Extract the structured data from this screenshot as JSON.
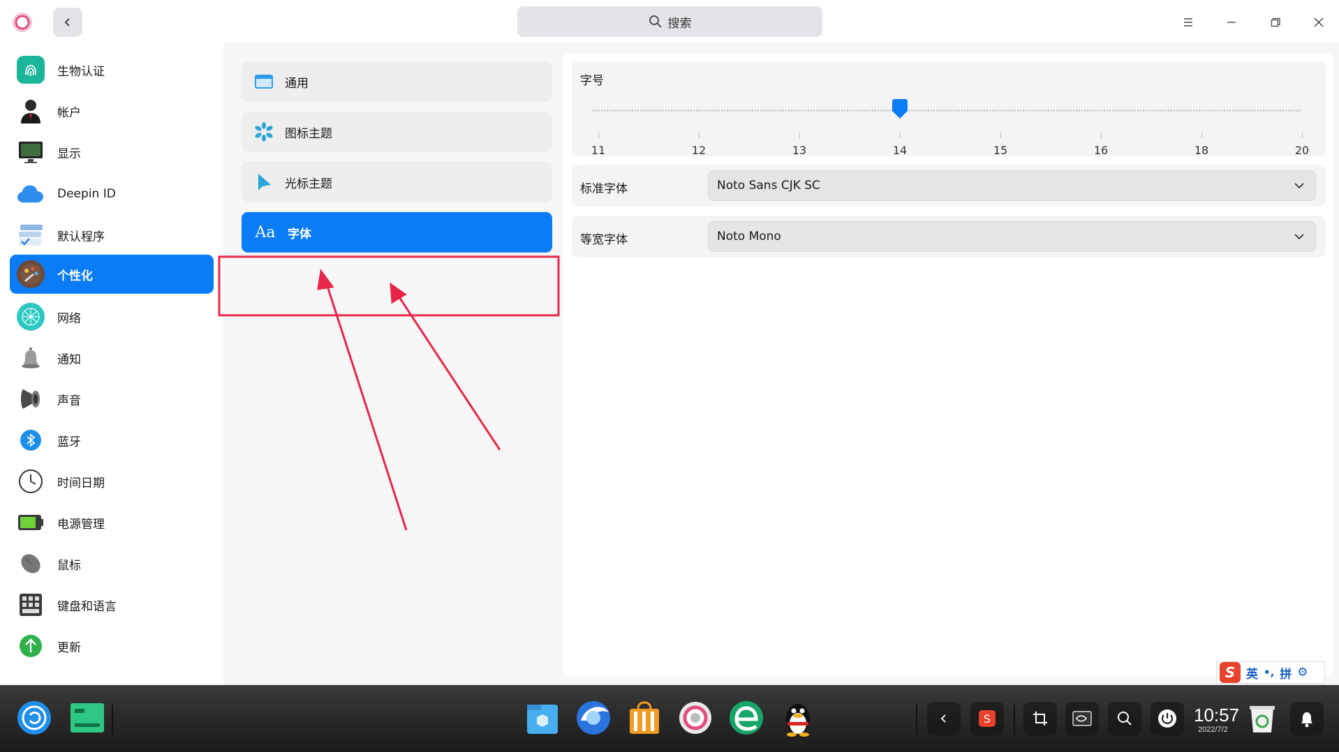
{
  "search": {
    "placeholder": "搜索"
  },
  "sidebar": {
    "items": [
      {
        "label": "生物认证",
        "icon": "fingerprint-icon"
      },
      {
        "label": "帐户",
        "icon": "account-icon"
      },
      {
        "label": "显示",
        "icon": "display-icon"
      },
      {
        "label": "Deepin ID",
        "icon": "cloud-icon"
      },
      {
        "label": "默认程序",
        "icon": "default-apps-icon"
      },
      {
        "label": "个性化",
        "icon": "personalization-icon",
        "active": true
      },
      {
        "label": "网络",
        "icon": "network-icon"
      },
      {
        "label": "通知",
        "icon": "bell-icon"
      },
      {
        "label": "声音",
        "icon": "speaker-icon"
      },
      {
        "label": "蓝牙",
        "icon": "bluetooth-icon"
      },
      {
        "label": "时间日期",
        "icon": "clock-icon"
      },
      {
        "label": "电源管理",
        "icon": "battery-icon"
      },
      {
        "label": "鼠标",
        "icon": "mouse-icon"
      },
      {
        "label": "键盘和语言",
        "icon": "keyboard-icon"
      },
      {
        "label": "更新",
        "icon": "update-icon"
      }
    ]
  },
  "submenu": {
    "items": [
      {
        "label": "通用",
        "icon": "window-icon"
      },
      {
        "label": "图标主题",
        "icon": "snowflake-icon"
      },
      {
        "label": "光标主题",
        "icon": "cursor-icon"
      },
      {
        "label": "字体",
        "icon": "font-icon",
        "icon_text": "Aa",
        "active": true
      }
    ]
  },
  "font_size": {
    "title": "字号",
    "ticks": [
      "11",
      "12",
      "13",
      "14",
      "15",
      "16",
      "18",
      "20"
    ],
    "selected": "14"
  },
  "standard_font": {
    "label": "标准字体",
    "value": "Noto Sans CJK SC"
  },
  "mono_font": {
    "label": "等宽字体",
    "value": "Noto Mono"
  },
  "ime": {
    "lang": "英",
    "mode": "拼"
  },
  "clock": {
    "time": "10:57",
    "date": "2022/7/2"
  },
  "colors": {
    "accent": "#0a7cf5",
    "annotation": "#e8264a"
  }
}
